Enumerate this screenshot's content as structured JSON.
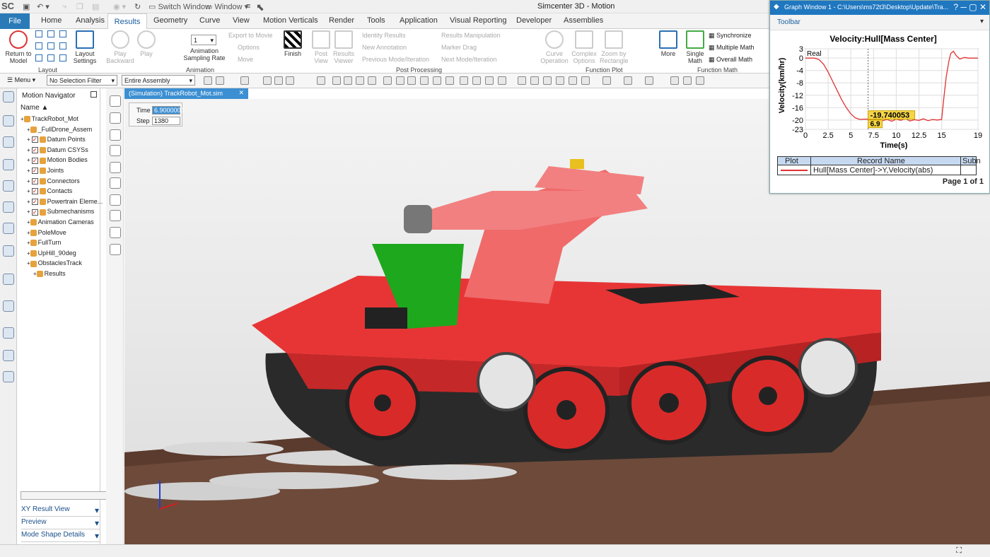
{
  "titlebar": {
    "logo": "SC",
    "switch_window": "Switch Window",
    "window_menu": "Window",
    "app_title": "Simcenter 3D - Motion"
  },
  "ribbon_tabs": [
    "File",
    "Home",
    "Analysis",
    "Results",
    "Geometry",
    "Curve",
    "View",
    "Motion Verticals",
    "Render",
    "Tools",
    "Application",
    "Visual Reporting",
    "Developer",
    "Assemblies"
  ],
  "ribbon": {
    "return_to_model": "Return to Model",
    "layout_settings": "Layout Settings",
    "group_layout": "Layout",
    "play_backward": "Play Backward",
    "play": "Play",
    "sampling_value": "1",
    "animation_sampling_rate": "Animation Sampling Rate",
    "finish": "Finish",
    "export_to_movie": "Export to Movie",
    "options": "Options",
    "move": "Move",
    "group_animation": "Animation",
    "post_view": "Post View",
    "results_viewer": "Results Viewer",
    "identity_results": "Identity Results",
    "new_annotation": "New Annotation",
    "previous_mode": "Previous Mode/Iteration",
    "results_manipulation": "Results Manipulation",
    "marker_drag": "Marker Drag",
    "next_mode": "Next Mode/Iteration",
    "group_post_processing": "Post Processing",
    "curve_operation": "Curve Operation",
    "complex_options": "Complex Options",
    "zoom_by_rectangle": "Zoom by Rectangle",
    "more": "More",
    "group_function_plot": "Function Plot",
    "single_math": "Single Math",
    "synchronize": "Synchronize",
    "multiple_math": "Multiple Math",
    "overall_math": "Overall Math",
    "group_function_math": "Function Math"
  },
  "toolbar2": {
    "menu": "Menu",
    "selection_filter": "No Selection Filter",
    "scope": "Entire Assembly"
  },
  "navigator": {
    "title": "Motion Navigator",
    "column": "Name",
    "items": [
      {
        "label": "TrackRobot_Mot",
        "indent": 0,
        "check": false
      },
      {
        "label": "_FullDrone_Assem",
        "indent": 1,
        "check": false
      },
      {
        "label": "Datum Points",
        "indent": 1,
        "check": true
      },
      {
        "label": "Datum CSYSs",
        "indent": 1,
        "check": true
      },
      {
        "label": "Motion Bodies",
        "indent": 1,
        "check": true
      },
      {
        "label": "Joints",
        "indent": 1,
        "check": true
      },
      {
        "label": "Connectors",
        "indent": 1,
        "check": true
      },
      {
        "label": "Contacts",
        "indent": 1,
        "check": true
      },
      {
        "label": "Powertrain Eleme...",
        "indent": 1,
        "check": true
      },
      {
        "label": "Submechanisms",
        "indent": 1,
        "check": true
      },
      {
        "label": "Animation Cameras",
        "indent": 1,
        "check": false
      },
      {
        "label": "PoleMove",
        "indent": 1,
        "check": false
      },
      {
        "label": "FullTurn",
        "indent": 1,
        "check": false
      },
      {
        "label": "UpHill_90deg",
        "indent": 1,
        "check": false
      },
      {
        "label": "ObstaclesTrack",
        "indent": 1,
        "check": false
      },
      {
        "label": "Results",
        "indent": 2,
        "check": false
      }
    ],
    "panels": [
      "XY Result View",
      "Preview",
      "Mode Shape Details"
    ]
  },
  "document_tab": "(Simulation) TrackRobot_Mot.sim",
  "animation": {
    "time_label": "Time",
    "time_value": "6.9000000",
    "step_label": "Step",
    "step_value": "1380"
  },
  "graph_window": {
    "title": "Graph Window 1 - C:\\Users\\ms72t3\\Desktop\\Update\\Tra...",
    "toolbar_label": "Toolbar",
    "table_headers": [
      "Plot",
      "Record Name",
      "Subn"
    ],
    "record_name": "Hull[Mass Center]->Y,Velocity(abs)",
    "page_count": "Page 1 of 1"
  },
  "chart_data": {
    "type": "line",
    "title": "Velocity:Hull[Mass Center]",
    "xlabel": "Time(s)",
    "ylabel": "Velocity(km/hr)",
    "legend": "Real",
    "legend_placement": "top-left",
    "xlim": [
      0,
      19
    ],
    "ylim": [
      -23,
      3
    ],
    "x_ticks": [
      "0",
      "2.5",
      "5",
      "7.5",
      "10",
      "12.5",
      "15",
      "19"
    ],
    "x_tick_values": [
      0,
      2.5,
      5,
      7.5,
      10,
      12.5,
      15,
      19
    ],
    "y_ticks": [
      "3",
      "0",
      "-4",
      "-8",
      "-12",
      "-16",
      "-20",
      "-23"
    ],
    "y_tick_values": [
      3,
      0,
      -4,
      -8,
      -12,
      -16,
      -20,
      -23
    ],
    "grid": true,
    "cursor_x": 6.9,
    "cursor_x_label": "6.9",
    "cursor_value": "-19.740053",
    "cursor_y": -19.74,
    "series": [
      {
        "color": "#e03030",
        "x": [
          0,
          0.5,
          1,
          1.5,
          2,
          2.5,
          3,
          3.5,
          4,
          4.5,
          5,
          5.5,
          6,
          6.5,
          6.9,
          7.5,
          8,
          8.5,
          9,
          9.5,
          10,
          10.5,
          11,
          11.5,
          12,
          12.5,
          13,
          13.5,
          14,
          14.5,
          15,
          15.2,
          15.5,
          15.8,
          16,
          16.3,
          16.6,
          17,
          17.5,
          18,
          18.5,
          19
        ],
        "y": [
          0,
          0,
          0,
          -0.5,
          -2,
          -4.5,
          -7.5,
          -10.5,
          -13.5,
          -16,
          -18,
          -19.3,
          -19.8,
          -19.7,
          -19.74,
          -20,
          -19.6,
          -20.2,
          -19.8,
          -20.4,
          -19.7,
          -20.1,
          -19.5,
          -20.3,
          -19.9,
          -20.1,
          -19.6,
          -20.2,
          -19.8,
          -20,
          -19.8,
          -14,
          -6,
          -1,
          1.5,
          2.2,
          0.8,
          -0.3,
          0.2,
          0,
          0,
          0
        ]
      }
    ]
  }
}
